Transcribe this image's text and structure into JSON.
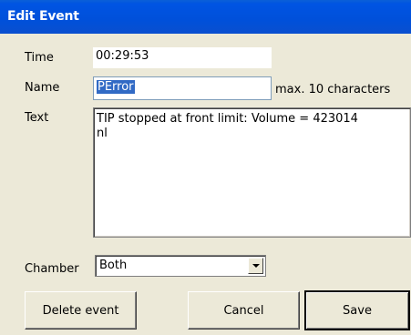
{
  "dialog": {
    "title": "Edit Event"
  },
  "fields": {
    "time_label": "Time",
    "time_value": "00:29:53",
    "name_label": "Name",
    "name_value": "PError",
    "name_hint": "max. 10 characters",
    "text_label": "Text",
    "text_line1": "TIP stopped at front limit:  Volume = 423014",
    "text_line2": "nl",
    "chamber_label": "Chamber",
    "chamber_value": "Both"
  },
  "buttons": {
    "delete_label": "Delete event",
    "cancel_label": "Cancel",
    "save_label": "Save"
  }
}
